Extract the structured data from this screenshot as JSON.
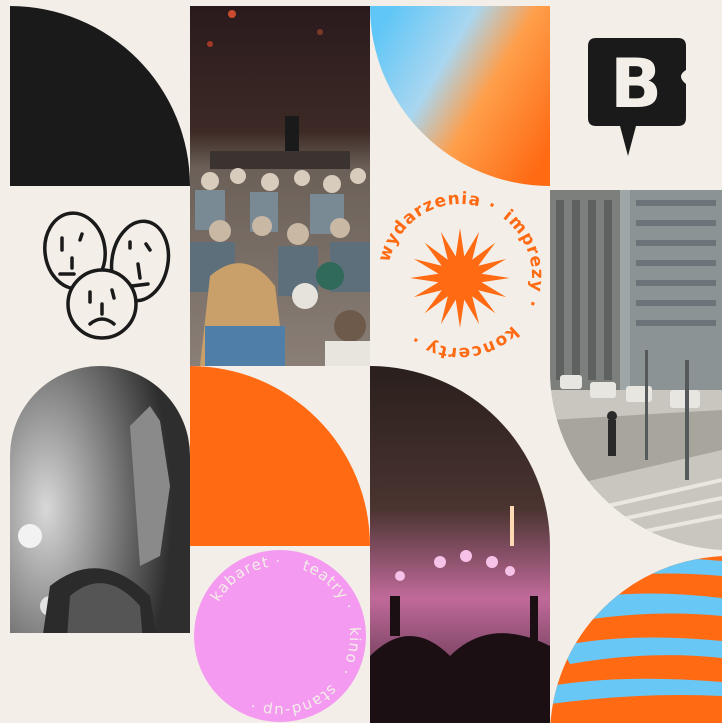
{
  "palette": {
    "background": "#f3efe8",
    "black": "#1b1a1a",
    "orange": "#ff6a13",
    "sky_blue": "#68c7f5",
    "pink": "#f49af0"
  },
  "badge_events": {
    "word_1": "wydarzenia",
    "word_2": "imprezy",
    "word_3": "koncerty",
    "separator": "·"
  },
  "badge_culture": {
    "word_1": "kabaret",
    "word_2": "teatry",
    "word_3": "kino",
    "word_4": "stand-up",
    "separator": "·"
  },
  "logo": {
    "letter": "B"
  },
  "icons": {
    "faces": "three-faces-doodle-icon",
    "star": "sixteen-point-star-icon",
    "logo": "speech-bubble-b-logo-icon"
  },
  "photos": {
    "festival_crowd": "festival-crowd-photo",
    "city_street": "city-street-photo",
    "dancer_bw": "dancer-bw-photo",
    "concert_stage": "concert-stage-photo"
  }
}
